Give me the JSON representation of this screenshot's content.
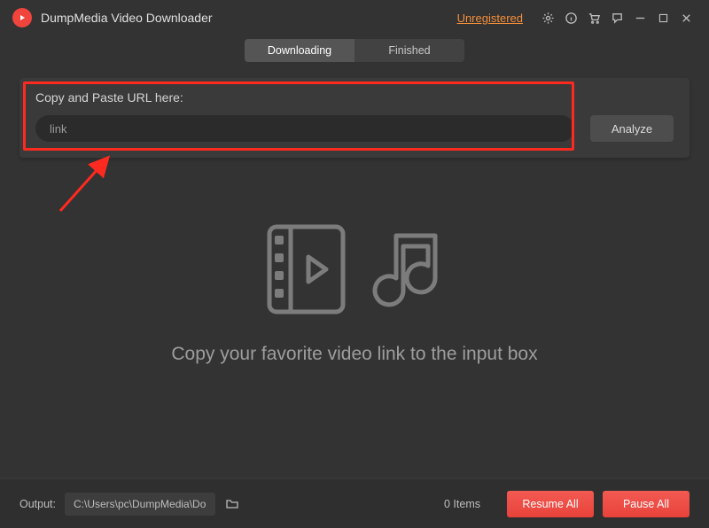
{
  "titlebar": {
    "app_name": "DumpMedia Video Downloader",
    "unregistered": "Unregistered"
  },
  "tabs": {
    "downloading": "Downloading",
    "finished": "Finished"
  },
  "url_panel": {
    "label": "Copy and Paste URL here:",
    "input_value": "link",
    "analyze": "Analyze"
  },
  "empty": {
    "message": "Copy your favorite video link to the input box"
  },
  "footer": {
    "output_label": "Output:",
    "output_path": "C:\\Users\\pc\\DumpMedia\\Do",
    "items": "0 Items",
    "resume": "Resume All",
    "pause": "Pause All"
  },
  "colors": {
    "accent_red": "#f0443c",
    "highlight": "#ff2a1f",
    "link_orange": "#f58f3a"
  }
}
